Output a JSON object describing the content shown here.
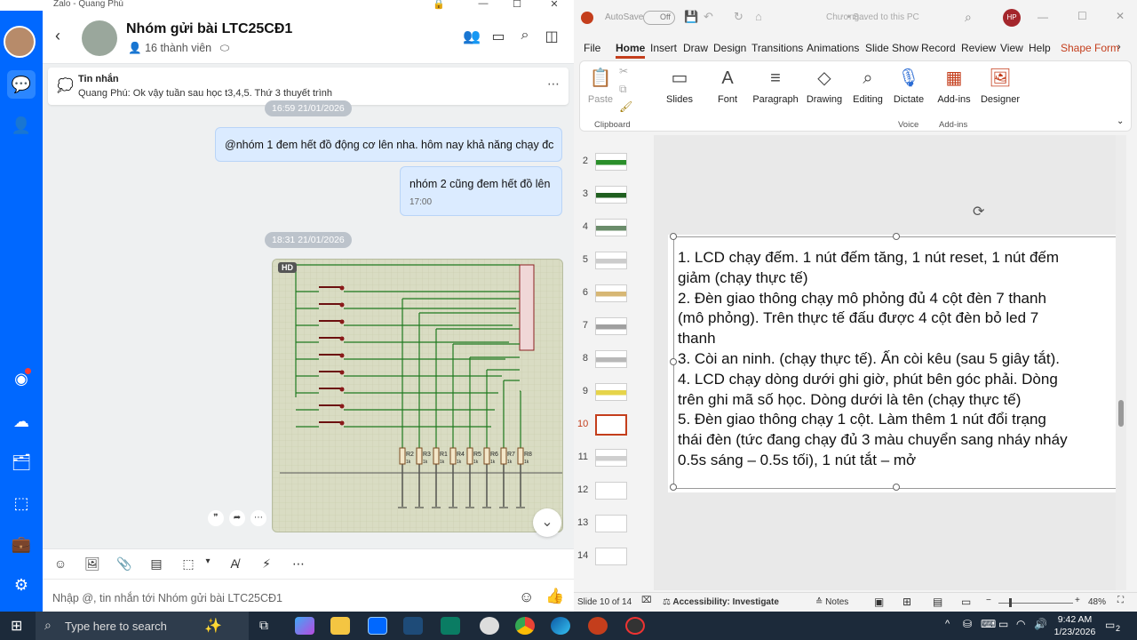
{
  "zalo": {
    "window_title": "Zalo - Quang Phú",
    "group_name": "Nhóm gửi bài LTC25CĐ1",
    "members": "16 thành viên",
    "pinned_title": "Tin nhắn",
    "pinned_text": "Quang Phú: Ok vậy tuần sau học t3,4,5. Thứ 3 thuyết trình",
    "messages": [
      {
        "time_above": "16:59 21/01/2026",
        "text": "@nhóm 1 đem hết đồ động cơ lên nha. hôm nay khả năng chạy đc"
      },
      {
        "text": "nhóm 2 cũng đem hết đồ lên",
        "time": "17:00"
      }
    ],
    "image_time": "18:31 21/01/2026",
    "hd_badge": "HD",
    "input_placeholder": "Nhập @, tin nhắn tới Nhóm gửi bài LTC25CĐ1",
    "schematic_labels": [
      "R2",
      "R3",
      "R1",
      "R4",
      "R5",
      "R6",
      "R7",
      "R8"
    ],
    "schematic_values": [
      "1k",
      "1k",
      "1k",
      "1k",
      "1k",
      "1k",
      "1k",
      "1k"
    ]
  },
  "ppt": {
    "autosave": "AutoSave",
    "autosave_state": "Off",
    "doc_name": "Chương...",
    "saved": "• Saved to this PC",
    "user_initials": "HP",
    "tabs": [
      "File",
      "Home",
      "Insert",
      "Draw",
      "Design",
      "Transitions",
      "Animations",
      "Slide Show",
      "Record",
      "Review",
      "View",
      "Help",
      "Shape Form"
    ],
    "ribbon": {
      "paste": "Paste",
      "clipboard": "Clipboard",
      "slides": "Slides",
      "font": "Font",
      "paragraph": "Paragraph",
      "drawing": "Drawing",
      "editing": "Editing",
      "dictate": "Dictate",
      "voice": "Voice",
      "addins": "Add-ins",
      "addins_group": "Add-ins",
      "designer": "Designer"
    },
    "slide_numbers": [
      "2",
      "3",
      "4",
      "5",
      "6",
      "7",
      "8",
      "9",
      "10",
      "11",
      "12",
      "13",
      "14"
    ],
    "active_slide": "10",
    "slide_lines": [
      "1. LCD chạy đếm. 1 nút đếm tăng, 1 nút reset, 1 nút đếm",
      "giảm (chạy thực tế)",
      "2. Đèn giao thông chạy mô phỏng đủ 4 cột đèn 7 thanh",
      "(mô phỏng). Trên thực tế đấu được 4 cột đèn bỏ led 7",
      "thanh",
      "3. Còi an ninh. (chạy thực tế). Ấn còi kêu (sau 5 giây tắt).",
      "4. LCD chạy dòng dưới ghi giờ, phút bên góc phải. Dòng",
      "trên ghi mã số học. Dòng dưới là tên (chạy thực tế)",
      "5. Đèn giao thông chạy 1 cột. Làm thêm 1 nút đổi trạng",
      "thái đèn (tức đang chạy đủ 3 màu chuyển sang nháy nháy",
      "0.5s sáng – 0.5s tối), 1 nút tắt – mở"
    ],
    "status": {
      "slide_of": "Slide 10 of 14",
      "accessibility": "Accessibility: Investigate",
      "notes": "Notes",
      "zoom": "48%"
    }
  },
  "taskbar": {
    "search_placeholder": "Type here to search",
    "time": "9:42 AM",
    "date": "1/23/2026",
    "notif_count": "2"
  }
}
